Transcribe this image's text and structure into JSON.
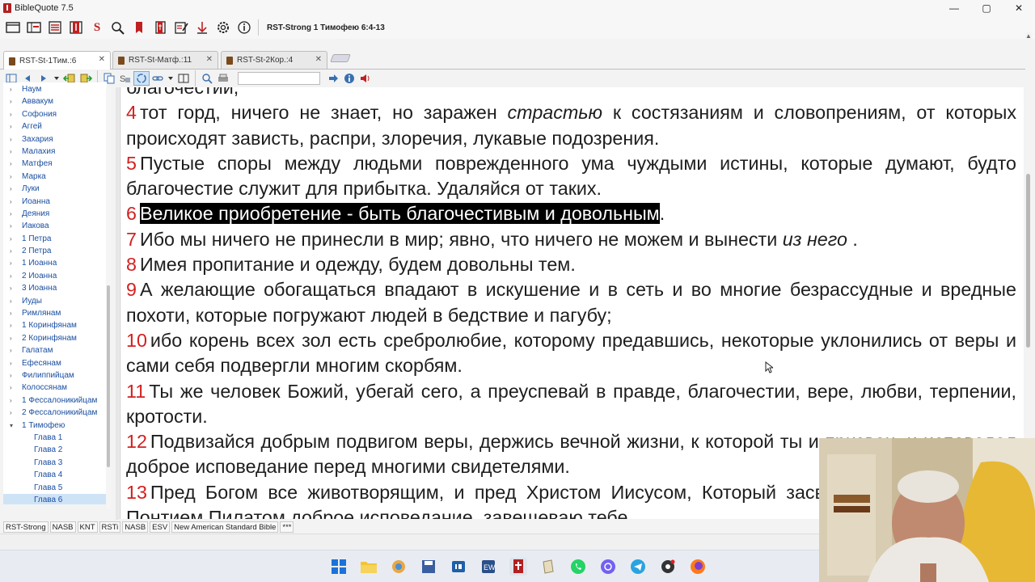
{
  "window": {
    "title": "BibleQuote 7.5",
    "controls": [
      "—",
      "▢",
      "✕"
    ]
  },
  "toolbar": {
    "reference": "RST-Strong 1 Тимофею 6:4-13"
  },
  "tabs": [
    {
      "label": "RST-St-1Тим.:6",
      "active": true
    },
    {
      "label": "RST-St-Матф.:11",
      "active": false
    },
    {
      "label": "RST-St-2Кор.:4",
      "active": false
    }
  ],
  "tree": {
    "items": [
      {
        "label": "Наум",
        "type": "book"
      },
      {
        "label": "Аввакум",
        "type": "book"
      },
      {
        "label": "Софония",
        "type": "book"
      },
      {
        "label": "Аггей",
        "type": "book"
      },
      {
        "label": "Захария",
        "type": "book"
      },
      {
        "label": "Малахия",
        "type": "book"
      },
      {
        "label": "Матфея",
        "type": "book"
      },
      {
        "label": "Марка",
        "type": "book"
      },
      {
        "label": "Луки",
        "type": "book"
      },
      {
        "label": "Иоанна",
        "type": "book"
      },
      {
        "label": "Деяния",
        "type": "book"
      },
      {
        "label": "Иакова",
        "type": "book"
      },
      {
        "label": "1 Петра",
        "type": "book"
      },
      {
        "label": "2 Петра",
        "type": "book"
      },
      {
        "label": "1 Иоанна",
        "type": "book"
      },
      {
        "label": "2 Иоанна",
        "type": "book"
      },
      {
        "label": "3 Иоанна",
        "type": "book"
      },
      {
        "label": "Иуды",
        "type": "book"
      },
      {
        "label": "Римлянам",
        "type": "book"
      },
      {
        "label": "1 Коринфянам",
        "type": "book"
      },
      {
        "label": "2 Коринфянам",
        "type": "book"
      },
      {
        "label": "Галатам",
        "type": "book"
      },
      {
        "label": "Ефесянам",
        "type": "book"
      },
      {
        "label": "Филиппийцам",
        "type": "book"
      },
      {
        "label": "Колоссянам",
        "type": "book"
      },
      {
        "label": "1 Фессалоникийцам",
        "type": "book"
      },
      {
        "label": "2 Фессалоникийцам",
        "type": "book"
      },
      {
        "label": "1 Тимофею",
        "type": "book",
        "expanded": true
      },
      {
        "label": "Глава 1",
        "type": "chapter"
      },
      {
        "label": "Глава 2",
        "type": "chapter"
      },
      {
        "label": "Глава 3",
        "type": "chapter"
      },
      {
        "label": "Глава 4",
        "type": "chapter"
      },
      {
        "label": "Глава 5",
        "type": "chapter"
      },
      {
        "label": "Глава 6",
        "type": "chapter",
        "selected": true
      }
    ]
  },
  "text": {
    "top_fragment": "благочестии,",
    "verses": [
      {
        "num": "4",
        "parts": [
          {
            "t": "тот горд, ничего не знает, но заражен "
          },
          {
            "t": "страстью",
            "i": true
          },
          {
            "t": " к состязаниям и словопрениям, от которых происходят зависть, распри, злоречия, лукавые подозрения."
          }
        ]
      },
      {
        "num": "5",
        "parts": [
          {
            "t": "Пустые споры между людьми поврежденного ума чуждыми истины, которые думают, будто благочестие служит для прибытка. Удаляйся от таких."
          }
        ]
      },
      {
        "num": "6",
        "parts": [
          {
            "t": "Великое приобретение - быть благочестивым и довольным",
            "h": true
          },
          {
            "t": "."
          }
        ]
      },
      {
        "num": "7",
        "parts": [
          {
            "t": "Ибо мы ничего не принесли в мир; явно, что ничего не можем и вынести "
          },
          {
            "t": "из него",
            "i": true
          },
          {
            "t": " ."
          }
        ]
      },
      {
        "num": "8",
        "parts": [
          {
            "t": "Имея пропитание и одежду, будем довольны тем."
          }
        ]
      },
      {
        "num": "9",
        "parts": [
          {
            "t": "А желающие обогащаться впадают в искушение и в сеть и во многие безрассудные и вредные похоти, которые погружают людей в бедствие и пагубу;"
          }
        ]
      },
      {
        "num": "10",
        "parts": [
          {
            "t": "ибо корень всех зол есть сребролюбие, которому предавшись, некоторые уклонились от веры и сами себя подвергли многим скорбям."
          }
        ]
      },
      {
        "num": "11",
        "parts": [
          {
            "t": "Ты же человек Божий, убегай сего, а преуспевай в правде, благочестии, вере, любви, терпении, кротости."
          }
        ]
      },
      {
        "num": "12",
        "parts": [
          {
            "t": "Подвизайся добрым подвигом веры, держись вечной жизни, к которой ты и призван, и исповедал доброе исповедание перед многими свидетелями."
          }
        ]
      },
      {
        "num": "13",
        "parts": [
          {
            "t": "Пред Богом все животворящим, и пред Христом Иисусом, Который засвидетельствовал пред Понтием Пилатом доброе исповедание, завещеваю тебе"
          }
        ]
      }
    ]
  },
  "modules": [
    "RST-Strong",
    "NASB",
    "KNT",
    "RSTi",
    "NASB",
    "ESV",
    "New American Standard Bible",
    "***"
  ],
  "colors": {
    "verse_number": "#d42020",
    "highlight_bg": "#000000",
    "highlight_fg": "#ffffff",
    "tree_text": "#1a4fa0"
  }
}
